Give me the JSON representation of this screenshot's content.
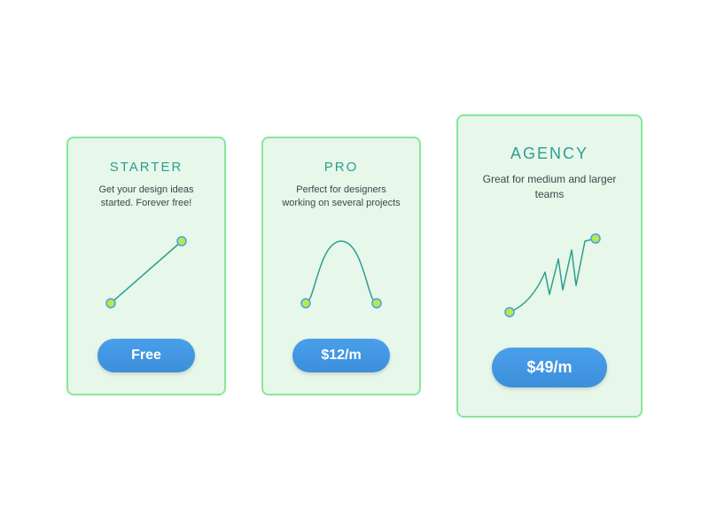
{
  "plans": [
    {
      "title": "STARTER",
      "description": "Get your design ideas started. Forever free!",
      "price_label": "Free"
    },
    {
      "title": "PRO",
      "description": "Perfect for designers working on several projects",
      "price_label": "$12/m"
    },
    {
      "title": "AGENCY",
      "description": "Great for medium and larger teams",
      "price_label": "$49/m"
    }
  ],
  "colors": {
    "card_bg": "#e7f7ea",
    "card_border": "#86e89a",
    "title_text": "#2c9f8f",
    "button_bg": "#4a9feb",
    "curve_stroke": "#2c9f8f",
    "dot_fill": "#b7e84a",
    "dot_stroke": "#4a9feb"
  }
}
